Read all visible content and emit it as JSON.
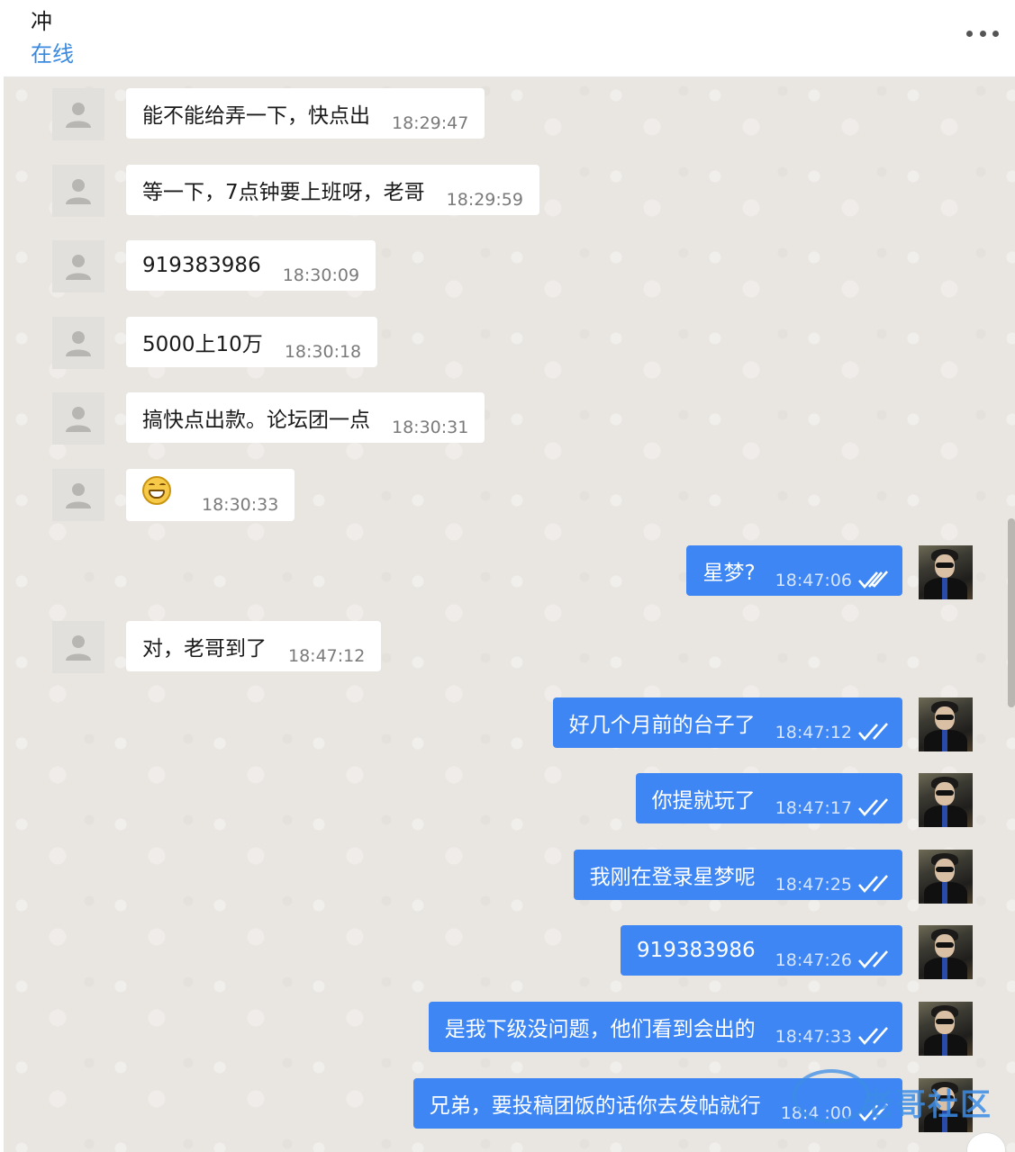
{
  "header": {
    "contact_name": "冲",
    "status": "在线",
    "more_icon": "more-horizontal-icon"
  },
  "messages": [
    {
      "dir": "in",
      "text": "能不能给弄一下，快点出",
      "time": "18:29:47"
    },
    {
      "dir": "in",
      "text": "等一下，7点钟要上班呀，老哥",
      "time": "18:29:59"
    },
    {
      "dir": "in",
      "text": "919383986",
      "time": "18:30:09"
    },
    {
      "dir": "in",
      "text": "5000上10万",
      "time": "18:30:18"
    },
    {
      "dir": "in",
      "text": "搞快点出款。论坛团一点",
      "time": "18:30:31"
    },
    {
      "dir": "in",
      "emoji": "grinning-face-emoji",
      "time": "18:30:33"
    },
    {
      "dir": "out",
      "text": "星梦?",
      "time": "18:47:06"
    },
    {
      "dir": "in",
      "text": "对，老哥到了",
      "time": "18:47:12"
    },
    {
      "dir": "out",
      "text": "好几个月前的台子了",
      "time": "18:47:12"
    },
    {
      "dir": "out",
      "text": "你提就玩了",
      "time": "18:47:17"
    },
    {
      "dir": "out",
      "text": "我刚在登录星梦呢",
      "time": "18:47:25"
    },
    {
      "dir": "out",
      "text": "919383986",
      "time": "18:47:26"
    },
    {
      "dir": "out",
      "text": "是我下级没问题，他们看到会出的",
      "time": "18:47:33"
    },
    {
      "dir": "out",
      "text": "兄弟，要投稿团饭的话你去发帖就行",
      "time": "18:4 :00"
    }
  ],
  "watermark": {
    "text": "老哥社区"
  },
  "colors": {
    "outgoing_bubble": "#3d86f3",
    "incoming_bubble": "#ffffff",
    "chat_background": "#e9e6e1",
    "status_text": "#3b8ae0"
  }
}
